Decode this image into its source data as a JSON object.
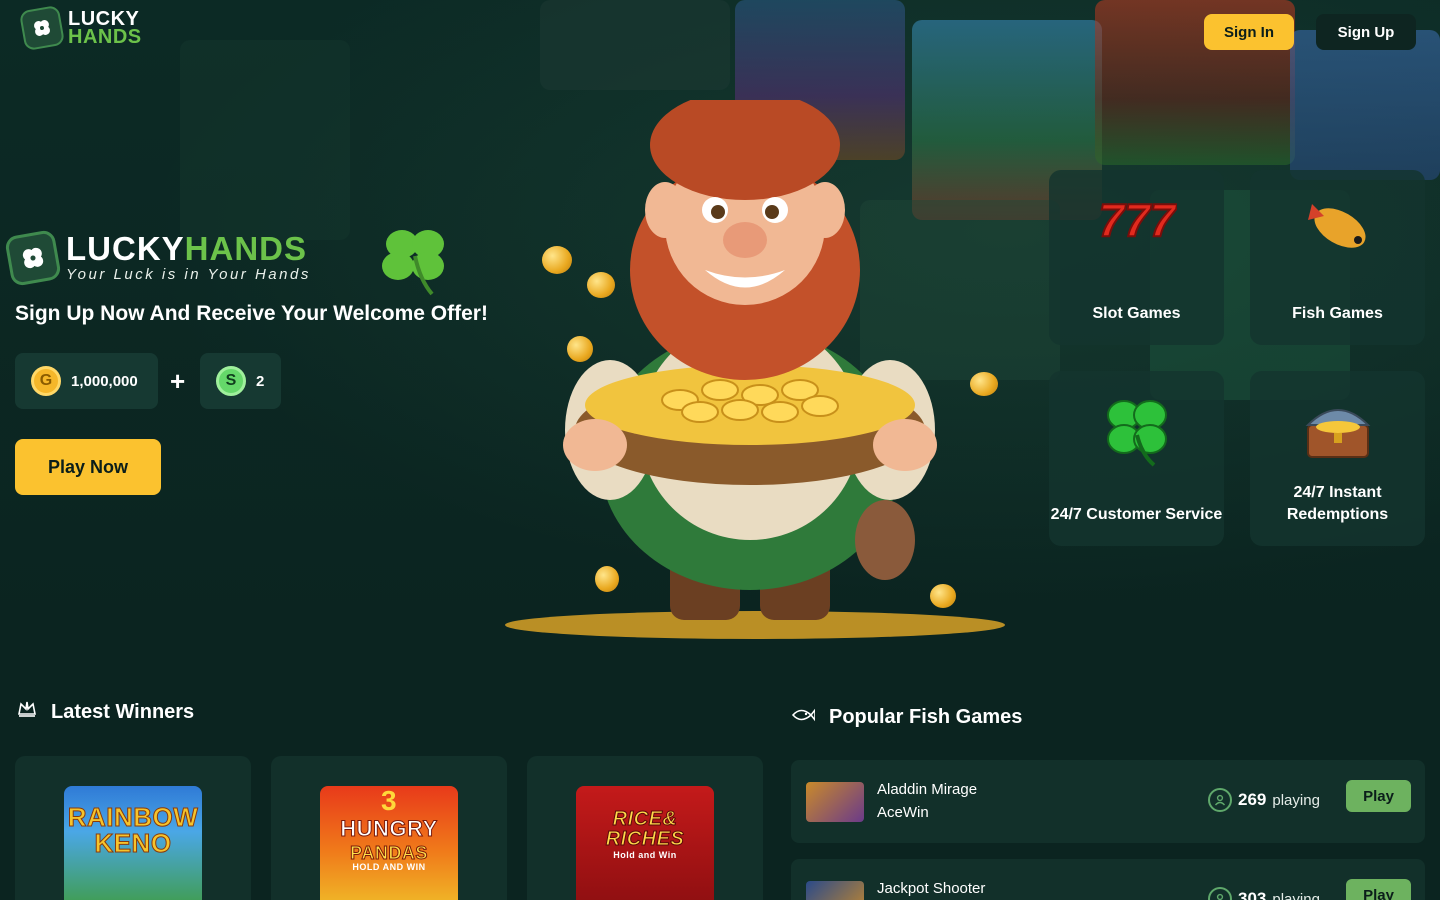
{
  "brand": {
    "line1": "LUCKY",
    "line2": "HANDS",
    "hero_lucky": "LUCKY",
    "hero_hands": "HANDS",
    "tagline": "Your Luck is in Your Hands"
  },
  "header": {
    "sign_in": "Sign In",
    "sign_up": "Sign Up"
  },
  "hero": {
    "headline": "Sign Up Now And Receive Your Welcome Offer!",
    "gold_coin_letter": "G",
    "gold_amount": "1,000,000",
    "plus": "+",
    "sweep_coin_letter": "S",
    "sweep_amount": "2",
    "play_now": "Play Now"
  },
  "features": [
    {
      "label": "Slot Games",
      "icon": "777-slot-icon"
    },
    {
      "label": "Fish Games",
      "icon": "fish-icon"
    },
    {
      "label": "24/7 Customer Service",
      "icon": "four-leaf-clover-icon"
    },
    {
      "label": "24/7 Instant Redemptions",
      "icon": "treasure-chest-icon"
    }
  ],
  "latest_winners": {
    "title": "Latest Winners",
    "games": [
      {
        "title_line1": "RAINBOW",
        "title_line2": "KENO"
      },
      {
        "title_line1": "3",
        "title_line2": "HUNGRY",
        "title_line3": "PANDAS",
        "subtitle": "HOLD AND WIN"
      },
      {
        "title_line1": "RICE&",
        "title_line2": "RICHES",
        "subtitle": "Hold and Win"
      }
    ]
  },
  "popular_fish": {
    "title": "Popular Fish Games",
    "playing_suffix": "playing",
    "play_label": "Play",
    "rows": [
      {
        "name": "Aladdin Mirage",
        "provider": "AceWin",
        "count": "269"
      },
      {
        "name": "Jackpot Shooter",
        "provider": "",
        "count": "303"
      }
    ]
  },
  "colors": {
    "background": "#0b2420",
    "accent_yellow": "#fbc22f",
    "brand_green": "#6cc24a",
    "card": "#12302a",
    "play_green": "#6db25f"
  }
}
